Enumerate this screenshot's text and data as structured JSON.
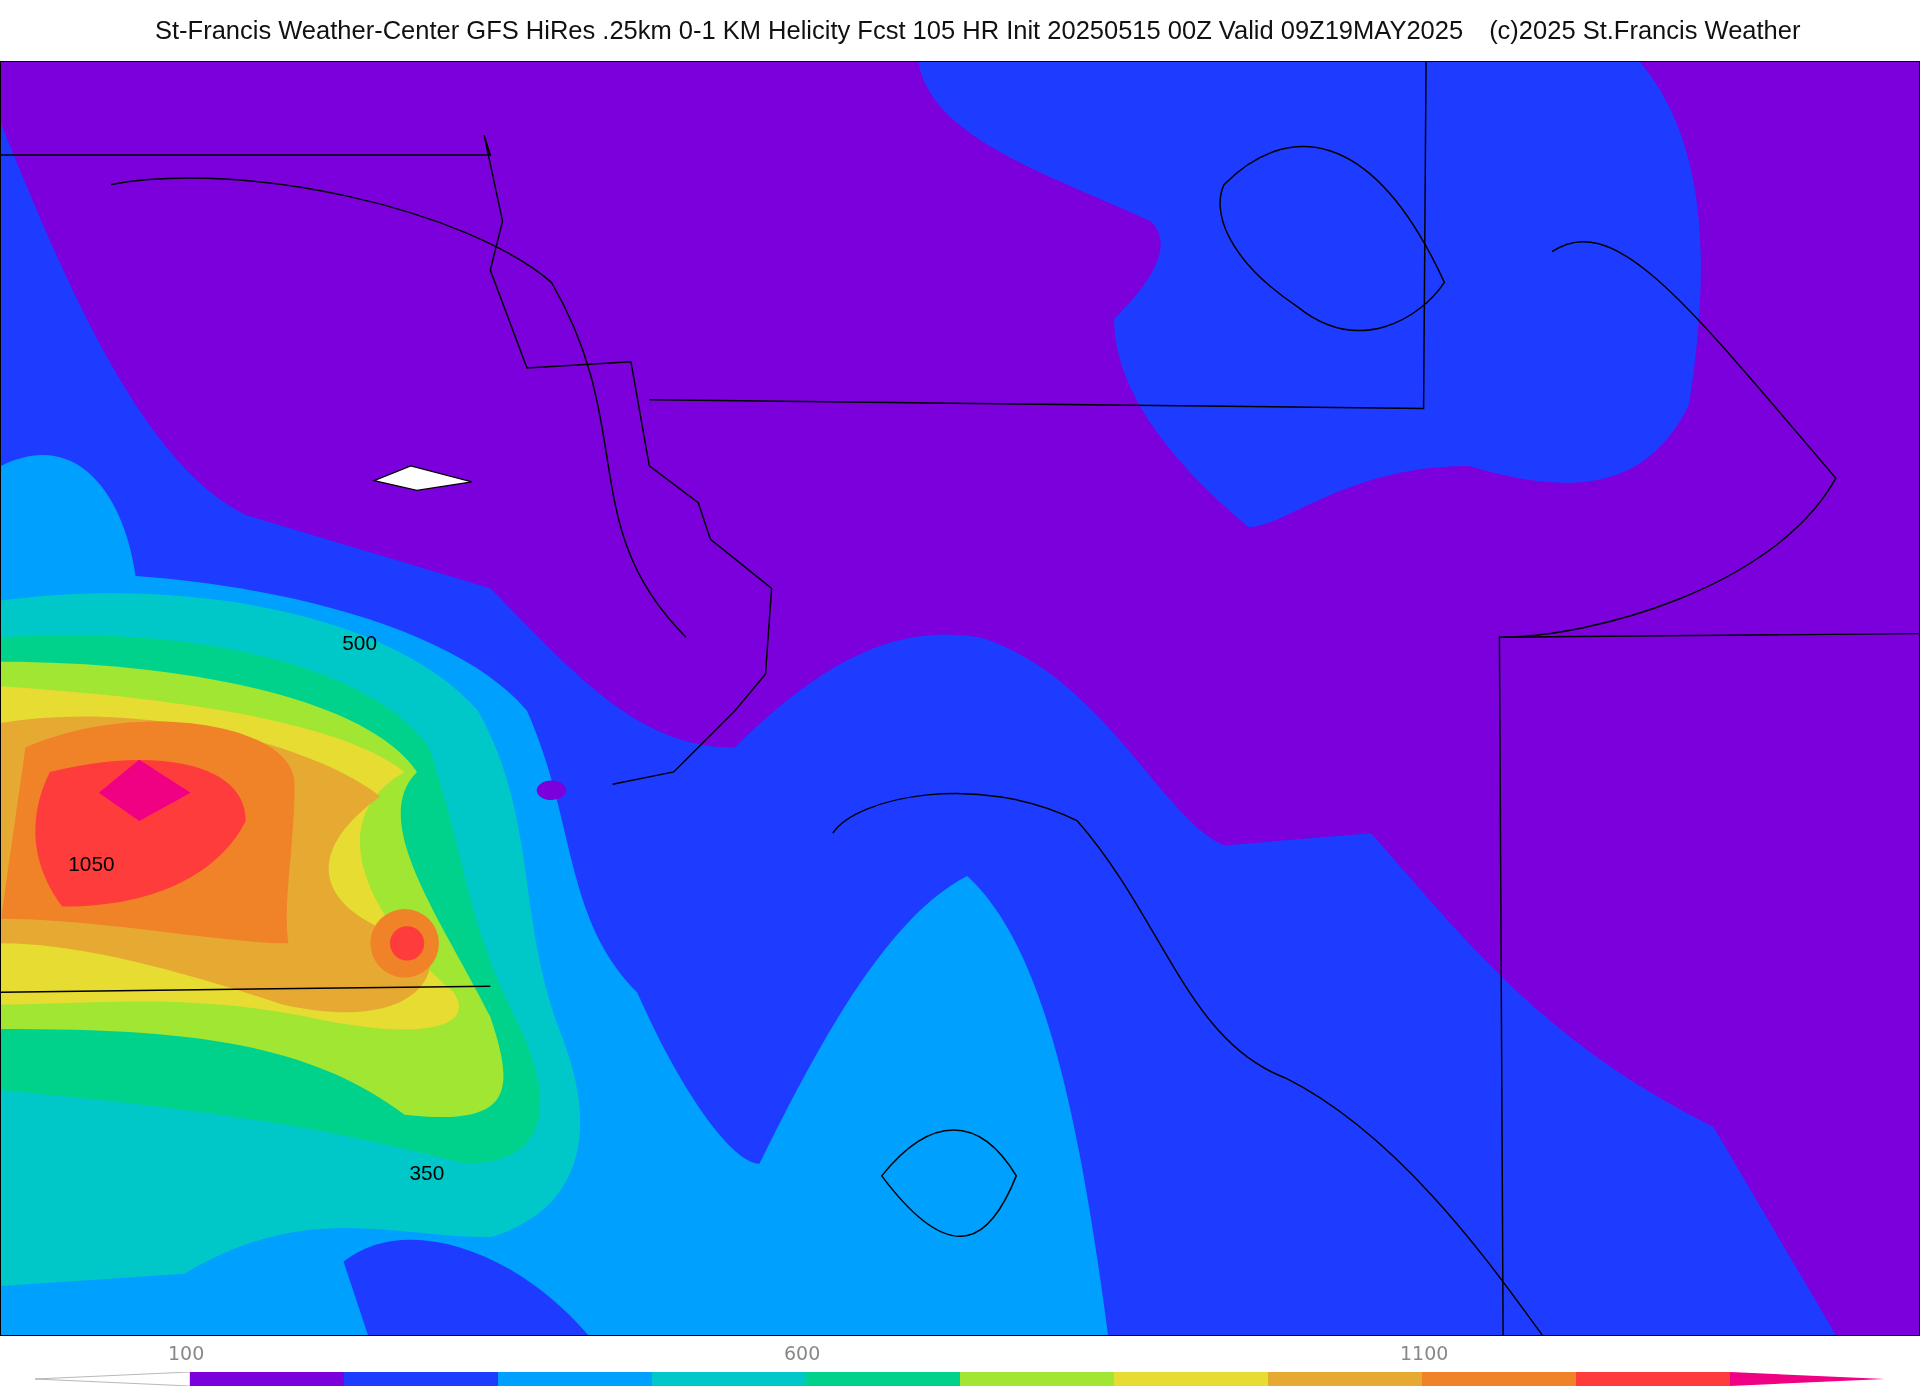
{
  "title": {
    "main": "St-Francis Weather-Center GFS HiRes .25km 0-1 KM Helicity Fcst 105 HR Init 20250515 00Z  Valid 09Z19MAY2025",
    "credit": "(c)2025 St.Francis Weather"
  },
  "map": {
    "contour_labels": [
      "500",
      "1050",
      "350"
    ]
  },
  "colorbar": {
    "segments": [
      {
        "color": "#7b00dc",
        "tick": "100"
      },
      {
        "color": "#1e3cff"
      },
      {
        "color": "#00a0ff"
      },
      {
        "color": "#00c8c8"
      },
      {
        "color": "#00d28c",
        "tick": "600"
      },
      {
        "color": "#a0e632"
      },
      {
        "color": "#e6dc32"
      },
      {
        "color": "#e6aa32"
      },
      {
        "color": "#f08228",
        "tick": "1100"
      },
      {
        "color": "#ff3c3c"
      }
    ],
    "max_arrow": {
      "color": "#f00082"
    }
  }
}
